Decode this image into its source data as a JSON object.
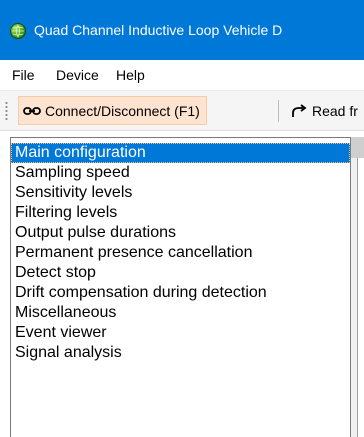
{
  "window": {
    "title": "Quad Channel Inductive Loop Vehicle D",
    "app_icon": "globe-icon"
  },
  "menu": {
    "items": [
      {
        "label": "File"
      },
      {
        "label": "Device"
      },
      {
        "label": "Help"
      }
    ]
  },
  "toolbar": {
    "connect": {
      "label": "Connect/Disconnect (F1)",
      "icon": "connect-plug-icon"
    },
    "read": {
      "label": "Read fr",
      "icon": "read-arrow-icon"
    }
  },
  "nav_list": {
    "selected_index": 0,
    "items": [
      {
        "label": "Main configuration"
      },
      {
        "label": "Sampling speed"
      },
      {
        "label": "Sensitivity levels"
      },
      {
        "label": "Filtering levels"
      },
      {
        "label": "Output pulse durations"
      },
      {
        "label": "Permanent presence cancellation"
      },
      {
        "label": "Detect stop"
      },
      {
        "label": "Drift compensation during detection"
      },
      {
        "label": "Miscellaneous"
      },
      {
        "label": "Event viewer"
      },
      {
        "label": "Signal analysis"
      }
    ]
  },
  "colors": {
    "titlebar": "#0078d7",
    "selection": "#0078d7",
    "toolbar_highlight": "#fde3d0"
  }
}
